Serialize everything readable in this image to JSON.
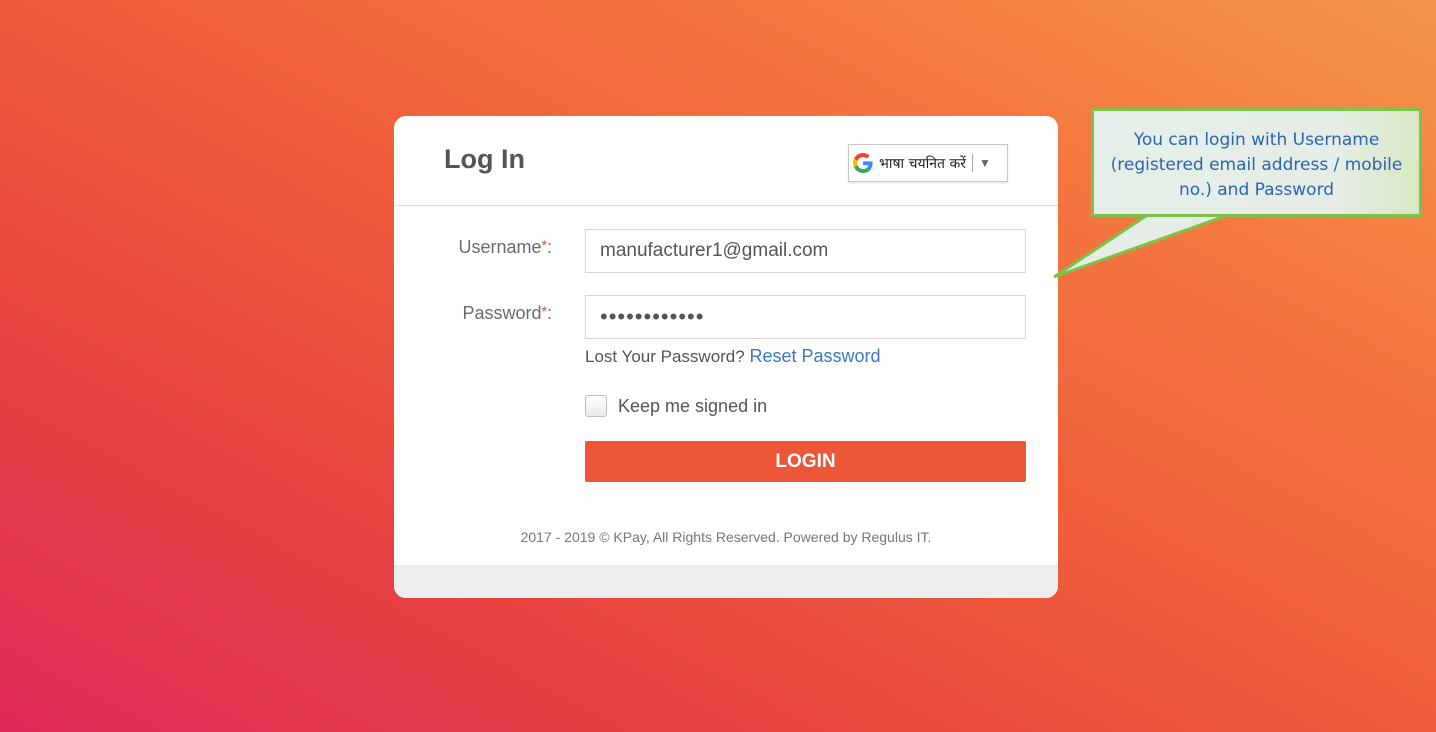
{
  "login_card": {
    "title": "Log In",
    "language_selector": {
      "icon": "google-g-icon",
      "label": "भाषा चयनित करें",
      "arrow": "▼"
    },
    "username": {
      "label": "Username",
      "required_mark": "*",
      "colon": ":",
      "value": "manufacturer1@gmail.com"
    },
    "password": {
      "label": "Password",
      "required_mark": "*",
      "colon": ":",
      "value": "••••••••••••"
    },
    "lost_password_text": "Lost Your Password?",
    "reset_link": "Reset Password",
    "keep_signed_in": {
      "label": "Keep me signed in",
      "checked": false
    },
    "login_button": "LOGIN",
    "footer": "2017 - 2019 © KPay, All Rights Reserved. Powered by Regulus IT."
  },
  "callout": {
    "lines": [
      "You can login with Username",
      "(registered email address / mobile",
      "no.) and Password"
    ]
  },
  "colors": {
    "accent": "#ec573a",
    "link": "#3a78c2",
    "callout_border": "#7fc24a",
    "callout_text": "#2a64b6"
  }
}
